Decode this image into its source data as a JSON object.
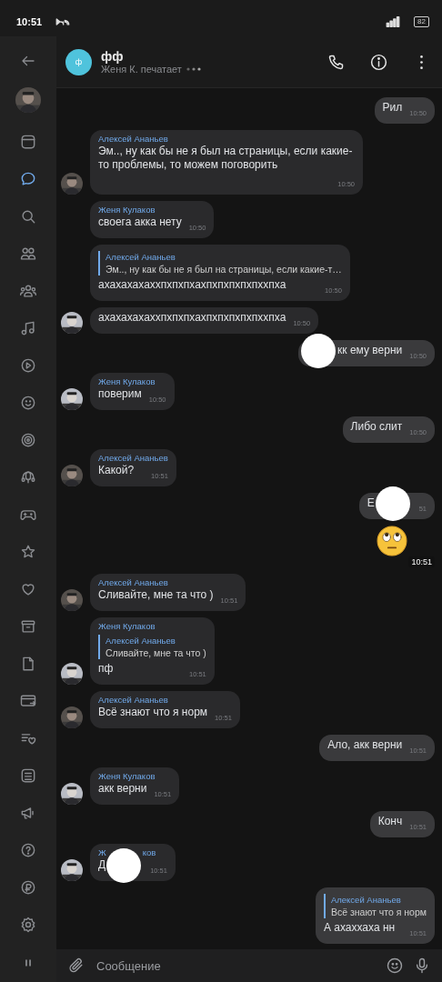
{
  "status_bar": {
    "time": "10:51",
    "battery": "82"
  },
  "sidebar": {
    "items": [
      {
        "selected": false
      },
      {
        "selected": true
      },
      {
        "selected": false
      },
      {
        "selected": false
      },
      {
        "selected": false
      },
      {
        "selected": false
      },
      {
        "selected": false
      },
      {
        "selected": false
      },
      {
        "selected": false
      },
      {
        "selected": false
      },
      {
        "selected": false
      },
      {
        "selected": false
      },
      {
        "selected": false
      },
      {
        "selected": false
      },
      {
        "selected": false
      },
      {
        "selected": false
      },
      {
        "selected": false
      },
      {
        "selected": false
      },
      {
        "selected": false
      },
      {
        "selected": false
      },
      {
        "selected": false
      },
      {
        "selected": false
      }
    ]
  },
  "header": {
    "avatar_letter": "ф",
    "title": "фф",
    "subtitle": "Женя К. печатает"
  },
  "messages": [
    {
      "kind": "out",
      "text": "Рил",
      "time": "10:50"
    },
    {
      "kind": "in",
      "avatar": true,
      "sender": "Алексей Ананьев",
      "text": "Эм.., ну как бы не я был на страницы, если какие-то проблемы, то можем поговорить",
      "time": "10:50"
    },
    {
      "kind": "in",
      "avatar": false,
      "sender": "Женя Кулаков",
      "text": "своега акка нету",
      "time": "10:50"
    },
    {
      "kind": "in",
      "avatar": false,
      "reply": {
        "sender": "Алексей Ананьев",
        "text": "Эм.., ну как бы не я был на страницы, если какие-т…"
      },
      "text": "ахахахахаххпхпхпхахпхпхпхпхпххпха",
      "time": "10:50"
    },
    {
      "kind": "in",
      "avatar": true,
      "text": "ахахахахаххпхпхпхахпхпхпхпхпххпха",
      "time": "10:50"
    },
    {
      "kind": "out",
      "cover_before": true,
      "text": "кк ему верни",
      "time": "10:50"
    },
    {
      "kind": "in",
      "avatar": true,
      "sender": "Женя Кулаков",
      "text": "поверим",
      "time": "10:50"
    },
    {
      "kind": "out",
      "text": "Либо слит",
      "time": "10:50"
    },
    {
      "kind": "in",
      "avatar": true,
      "sender": "Алексей Ананьев",
      "text": "Какой?",
      "time": "10:51"
    },
    {
      "kind": "out",
      "cover_after": true,
      "text": "Е",
      "time": "51"
    },
    {
      "kind": "sticker",
      "time": "10:51"
    },
    {
      "kind": "in",
      "avatar": true,
      "sender": "Алексей Ананьев",
      "text": "Сливайте, мне та что )",
      "time": "10:51"
    },
    {
      "kind": "in",
      "avatar": true,
      "sender": "Женя Кулаков",
      "reply": {
        "sender": "Алексей Ананьев",
        "text": "Сливайте, мне та что )"
      },
      "text": "пф",
      "time": "10:51"
    },
    {
      "kind": "in",
      "avatar": true,
      "sender": "Алексей Ананьев",
      "text": "Всё знают что я норм",
      "time": "10:51"
    },
    {
      "kind": "out",
      "text": "Ало, акк верни",
      "time": "10:51"
    },
    {
      "kind": "in",
      "avatar": true,
      "sender": "Женя Кулаков",
      "text": "акк верни",
      "time": "10:51"
    },
    {
      "kind": "out",
      "text": "Конч",
      "time": "10:51"
    },
    {
      "kind": "in",
      "avatar": true,
      "sender": "Ж",
      "sender_end": "ков",
      "cover_after": true,
      "text": "Д",
      "time": "10:51"
    },
    {
      "kind": "out",
      "reply": {
        "sender": "Алексей Ананьев",
        "text": "Всё знают что я норм"
      },
      "text": "А ахаххаха нн",
      "time": "10:51"
    }
  ],
  "composer": {
    "placeholder": "Сообщение"
  }
}
